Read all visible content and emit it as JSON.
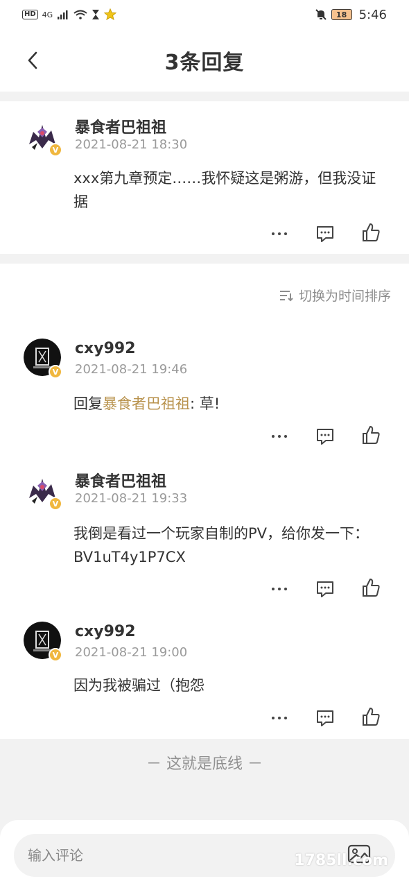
{
  "status_bar": {
    "left_badge": "HD",
    "signal": "4G",
    "time": "5:46",
    "battery": "18"
  },
  "header": {
    "title": "3条回复",
    "back_icon": "chevron-left-icon"
  },
  "main_comment": {
    "username": "暴食者巴祖祖",
    "timestamp": "2021-08-21 18:30",
    "text": "xxx第九章预定……我怀疑这是粥游，但我没证据"
  },
  "sort_toggle": {
    "label": "切换为时间排序",
    "icon": "sort-icon"
  },
  "replies": [
    {
      "username": "cxy992",
      "timestamp": "2021-08-21 19:46",
      "reply_prefix": "回复",
      "reply_to": "暴食者巴祖祖",
      "reply_suffix": ": 草!"
    },
    {
      "username": "暴食者巴祖祖",
      "timestamp": "2021-08-21 19:33",
      "text": "我倒是看过一个玩家自制的PV，给你发一下：BV1uT4y1P7CX"
    },
    {
      "username": "cxy992",
      "timestamp": "2021-08-21 19:00",
      "text": "因为我被骗过（抱怨"
    }
  ],
  "vip_badge": "V",
  "footer": {
    "end_line": "－ 这就是底线 －",
    "input_placeholder": "输入评论",
    "image_icon": "image-icon",
    "watermark": "1785ll.com"
  },
  "colors": {
    "accent_reply": "#b8924c",
    "vip_badge": "#f0b73f",
    "background_gray": "#f2f2f2"
  }
}
